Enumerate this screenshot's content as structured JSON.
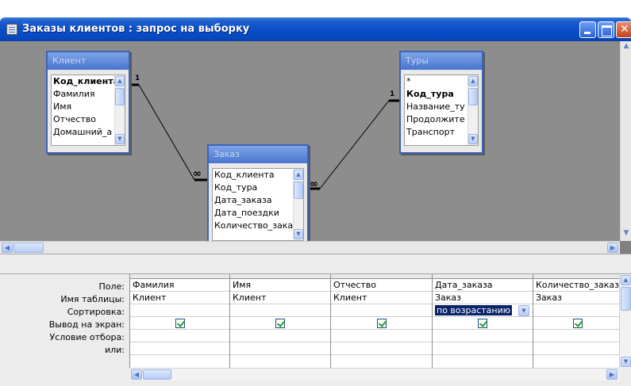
{
  "window": {
    "title": "Заказы клиентов : запрос на выборку"
  },
  "tables": {
    "client": {
      "name": "Клиент",
      "fields": [
        "Код_клиента",
        "Фамилия",
        "Имя",
        "Отчество",
        "Домашний_а"
      ]
    },
    "tours": {
      "name": "Туры",
      "fields": [
        "*",
        "Код_тура",
        "Название_ту",
        "Продолжите",
        "Транспорт"
      ]
    },
    "order": {
      "name": "Заказ",
      "fields": [
        "Код_клиента",
        "Код_тура",
        "Дата_заказа",
        "Дата_поездки",
        "Количество_зака"
      ]
    }
  },
  "relations": {
    "one_label": "1",
    "many_label": "∞"
  },
  "grid": {
    "row_labels": [
      "Поле:",
      "Имя таблицы:",
      "Сортировка:",
      "Вывод на экран:",
      "Условие отбора:",
      "или:"
    ],
    "columns": [
      {
        "field": "Фамилия",
        "table": "Клиент",
        "sort": "",
        "show": true
      },
      {
        "field": "Имя",
        "table": "Клиент",
        "sort": "",
        "show": true
      },
      {
        "field": "Отчество",
        "table": "Клиент",
        "sort": "",
        "show": true
      },
      {
        "field": "Дата_заказа",
        "table": "Заказ",
        "sort": "по возрастанию",
        "show": true
      },
      {
        "field": "Количество_заказ",
        "table": "Заказ",
        "sort": "",
        "show": true
      }
    ]
  },
  "colors": {
    "titlebar": "#0a4fc8",
    "table_header": "#4775cf",
    "selection": "#0a246a"
  }
}
